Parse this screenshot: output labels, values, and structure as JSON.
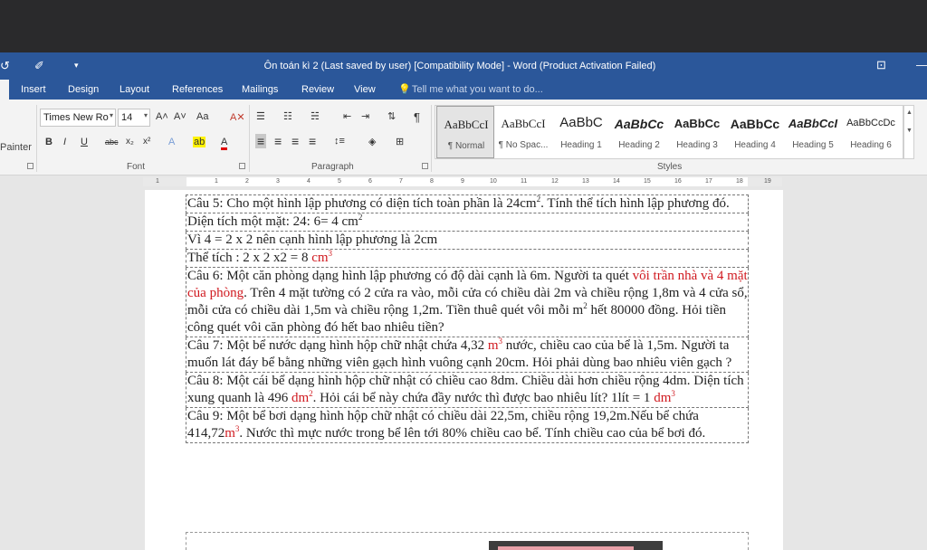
{
  "quick_access": {
    "undo_icon": "undo-icon",
    "brush_icon": "format-painter-icon",
    "more_icon": "customize-icon",
    "undo_glyph": "↺",
    "brush_glyph": "✐",
    "more_glyph": "▾"
  },
  "window": {
    "title": "Ôn toán kì 2 (Last saved by user) [Compatibility Mode] - Word (Product Activation Failed)",
    "ribbon_display_glyph": "⊡",
    "minimize_glyph": "—"
  },
  "tabs": [
    "Insert",
    "Design",
    "Layout",
    "References",
    "Mailings",
    "Review",
    "View"
  ],
  "tell_me": {
    "placeholder": "Tell me what you want to do...",
    "icon": "lightbulb-icon",
    "glyph": "💡"
  },
  "clipboard": {
    "painter_label": "Painter"
  },
  "font": {
    "group_label": "Font",
    "name": "Times New Ro",
    "size": "14",
    "grow_glyph": "A˄",
    "shrink_glyph": "A˅",
    "case_glyph": "Aa",
    "clear_glyph": "A✕",
    "bold": "B",
    "italic": "I",
    "underline": "U",
    "strike": "abc",
    "subscript": "x₂",
    "superscript": "x²",
    "effects_glyph": "A",
    "highlight_glyph": "ab",
    "color_glyph": "A"
  },
  "paragraph": {
    "group_label": "Paragraph",
    "bullets_glyph": "☰",
    "numbering_glyph": "☷",
    "multilevel_glyph": "☵",
    "decrease_indent_glyph": "⇤",
    "increase_indent_glyph": "⇥",
    "sort_glyph": "⇅",
    "pilcrow_glyph": "¶",
    "align_left_glyph": "≡",
    "center_glyph": "≡",
    "right_glyph": "≡",
    "justify_glyph": "≡",
    "spacing_glyph": "↕≡",
    "shading_glyph": "◈",
    "borders_glyph": "⊞"
  },
  "styles": {
    "group_label": "Styles",
    "items": [
      {
        "sample": "AaBbCcI",
        "name": "¶ Normal"
      },
      {
        "sample": "AaBbCcI",
        "name": "¶ No Spac..."
      },
      {
        "sample": "AaBbC",
        "name": "Heading 1"
      },
      {
        "sample": "AaBbCc",
        "name": "Heading 2"
      },
      {
        "sample": "AaBbCc",
        "name": "Heading 3"
      },
      {
        "sample": "AaBbCc",
        "name": "Heading 4"
      },
      {
        "sample": "AaBbCcI",
        "name": "Heading 5"
      },
      {
        "sample": "AaBbCcDc",
        "name": "Heading 6"
      }
    ],
    "scroll_up": "▲",
    "scroll_down": "▼"
  },
  "ruler": {
    "numbers": [
      "1",
      "1",
      "2",
      "3",
      "4",
      "5",
      "6",
      "7",
      "8",
      "9",
      "10",
      "11",
      "12",
      "13",
      "14",
      "15",
      "16",
      "17",
      "18",
      "19"
    ]
  },
  "document": {
    "q5": {
      "a": "Câu 5: Cho một hình lập phương có diện tích toàn phần là 24cm",
      "sup": "2",
      "b": ". Tính thể tích hình lập phương đó."
    },
    "area": {
      "a": "Diện tích một mặt: 24: 6= 4 cm",
      "sup": "2"
    },
    "since": "Vì 4 = 2 x 2 nên cạnh hình lập phương là 2cm",
    "volume": {
      "a": "Thể tích : 2 x 2 x2 = 8 ",
      "red": "cm",
      "sup": "3"
    },
    "q6": {
      "a": "Câu 6: Một căn phòng dạng hình lập phương có độ dài cạnh là 6m. Người ta quét ",
      "red": "vôi trần nhà và 4 mặt của phòng",
      "b": ". Trên 4 mặt tường có 2 cửa ra vào, mỗi cửa có chiều dài 2m và chiều rộng 1,8m và 4 cửa sổ, mỗi cửa có chiều dài 1,5m và chiều rộng 1,2m. Tiền thuê quét vôi mỗi m",
      "sup": "2",
      "c": " hết 80000 đồng. Hỏi tiền công quét vôi căn phòng đó hết bao nhiêu tiền?"
    },
    "q7": {
      "a": "Câu 7: Một bể nước dạng hình hộp chữ nhật chứa 4,32 ",
      "red": "m",
      "sup": "3",
      "b": " nước, chiều cao của bể là 1,5m. Người ta muốn lát đáy bể bằng những viên gạch hình vuông cạnh 20cm. Hỏi phải dùng bao nhiêu viên gạch ?"
    },
    "q8": {
      "a": "Câu 8: Một cái bể dạng hình hộp chữ nhật có chiều cao 8dm. Chiều dài hơn chiều rộng 4dm. Diện tích xung quanh là 496 ",
      "red1": "dm",
      "sup1": "2",
      "b": ". Hỏi cái bể này chứa đầy nước thì được bao nhiêu lít? 1lít = 1 ",
      "red2": "dm",
      "sup2": "3"
    },
    "q9": {
      "a": "Câu 9: Một bể bơi dạng hình hộp chữ nhật có chiều dài 22,5m, chiều rộng 19,2m.Nếu bể chứa 414,72",
      "red": "m",
      "sup": "3",
      "b": ". Nước thì mực nước trong bể lên tới 80% chiều cao bể. Tính chiều cao của bể bơi đó."
    }
  }
}
